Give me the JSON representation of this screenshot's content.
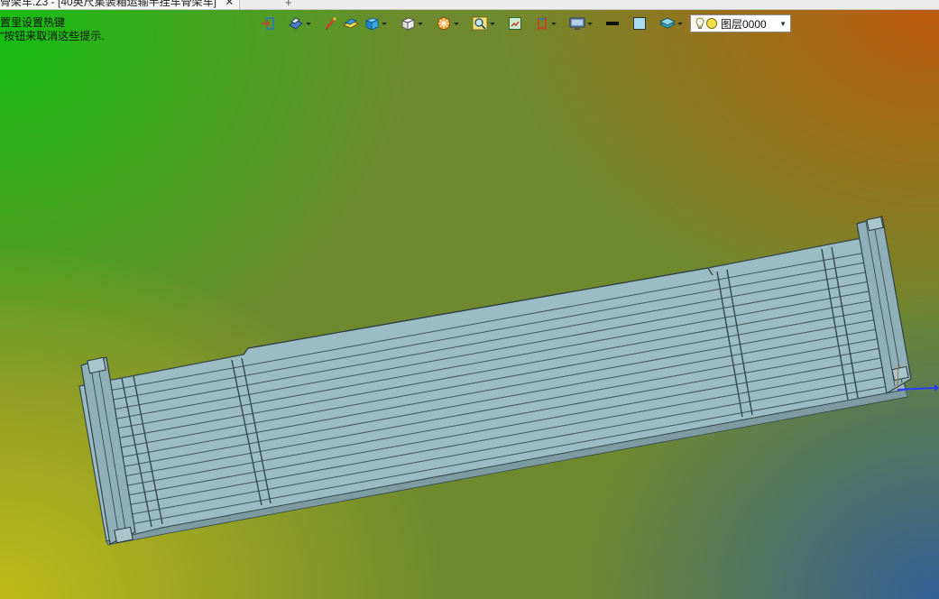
{
  "window": {
    "tab_title": "骨架车.Z3 - [40英尺集装箱运输半挂车骨架车]",
    "tab_close": "✕",
    "new_tab": "+"
  },
  "hint": {
    "line1": "置里设置热键",
    "line2": "\"按钮来取消这些提示."
  },
  "toolbar": {
    "items": [
      {
        "icon": "exit-icon",
        "dropdown": false
      },
      {
        "icon": "view-orient-icon",
        "dropdown": true
      },
      {
        "icon": "sketch-pen-icon",
        "dropdown": false
      },
      {
        "icon": "surface-icon",
        "dropdown": false
      },
      {
        "icon": "solid-box-icon",
        "dropdown": true
      },
      {
        "icon": "white-cube-icon",
        "dropdown": true
      },
      {
        "icon": "render-ball-icon",
        "dropdown": true
      },
      {
        "icon": "zoom-icon",
        "dropdown": true
      },
      {
        "icon": "zoom-fit-icon",
        "dropdown": false
      },
      {
        "icon": "axis-icon",
        "dropdown": true
      },
      {
        "icon": "monitor-icon",
        "dropdown": true
      },
      {
        "icon": "line-color-icon",
        "dropdown": false
      },
      {
        "icon": "fill-color-icon",
        "dropdown": false
      },
      {
        "icon": "layer-stack-icon",
        "dropdown": true
      }
    ],
    "layer": {
      "name": "图层0000",
      "bulb_color": "#f2e24a"
    }
  },
  "colors": {
    "model_fill": "#9bbcc4",
    "model_line": "#35474c",
    "axis_x": "#2a3cff"
  }
}
